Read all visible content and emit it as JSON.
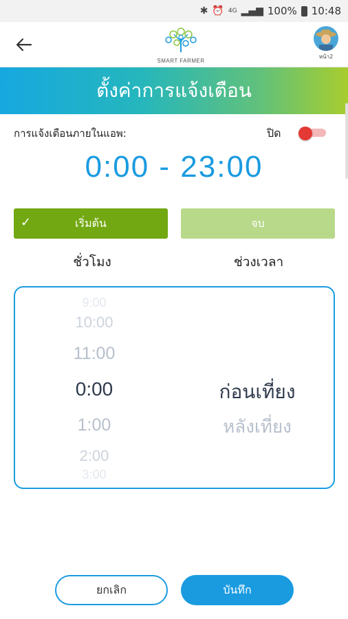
{
  "status_bar": {
    "icons": [
      "bluetooth-icon",
      "alarm-icon",
      "data-4g-icon",
      "signal-icon",
      "battery-icon"
    ],
    "battery": "100%",
    "time": "10:48"
  },
  "header": {
    "back_icon": "arrow-left-icon",
    "logo_text": "SMART FARMER",
    "avatar_label": "หน้า2"
  },
  "title": "ตั้งค่าการแจ้งเตือน",
  "notification": {
    "label": "การแจ้งเตือนภายในแอพ:",
    "state": "ปิด",
    "toggle_on": false
  },
  "time_range": "0:00 - 23:00",
  "tabs": {
    "start": "เริ่มต้น",
    "end": "จบ",
    "active": "start"
  },
  "picker": {
    "hour_header": "ชั่วโมง",
    "period_header": "ช่วงเวลา",
    "hours": [
      "9:00",
      "10:00",
      "11:00",
      "0:00",
      "1:00",
      "2:00",
      "3:00"
    ],
    "selected_hour": "0:00",
    "periods": [
      "ก่อนเที่ยง",
      "หลังเที่ยง"
    ],
    "selected_period": "ก่อนเที่ยง"
  },
  "buttons": {
    "cancel": "ยกเลิก",
    "save": "บันทึก"
  },
  "colors": {
    "accent_blue": "#1a9be0",
    "green_active": "#72a812",
    "green_inactive": "#b8d98a",
    "toggle_off_red": "#e53935"
  }
}
